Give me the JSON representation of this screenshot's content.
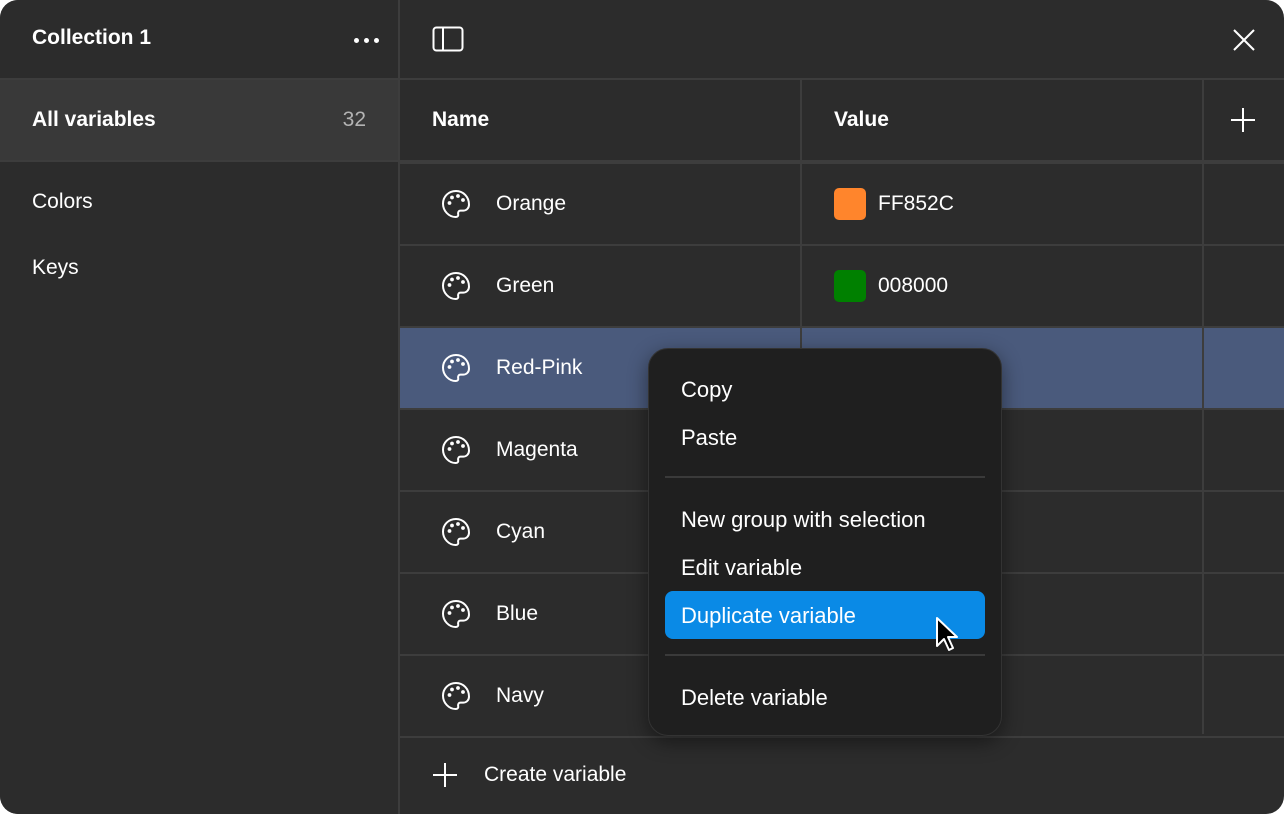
{
  "sidebar": {
    "title": "Collection 1",
    "more_icon": "more-horizontal-icon",
    "all_label": "All variables",
    "all_count": "32",
    "groups": [
      "Colors",
      "Keys"
    ]
  },
  "toolbar": {
    "panel_icon": "sidebar-toggle-icon",
    "close_icon": "close-icon"
  },
  "table": {
    "columns": [
      "Name",
      "Value"
    ],
    "add_icon": "plus-icon",
    "rows": [
      {
        "name": "Orange",
        "value": "FF852C",
        "swatch": "#ff852c"
      },
      {
        "name": "Green",
        "value": "008000",
        "swatch": "#008000"
      },
      {
        "name": "Red-Pink",
        "value": "",
        "swatch": ""
      },
      {
        "name": "Magenta",
        "value": "",
        "swatch": ""
      },
      {
        "name": "Cyan",
        "value": "",
        "swatch": ""
      },
      {
        "name": "Blue",
        "value": "",
        "swatch": ""
      },
      {
        "name": "Navy",
        "value": "",
        "swatch": ""
      }
    ],
    "selected_row": "Red-Pink",
    "create_label": "Create variable"
  },
  "context_menu": {
    "items": [
      "Copy",
      "Paste",
      "New group with selection",
      "Edit variable",
      "Duplicate variable",
      "Delete variable"
    ],
    "highlighted": "Duplicate variable"
  },
  "colors": {
    "background": "#2c2c2c",
    "selected_row": "#4a5a7c",
    "menu_highlight": "#0a8ae6",
    "orange": "#ff852c",
    "green": "#008000"
  }
}
